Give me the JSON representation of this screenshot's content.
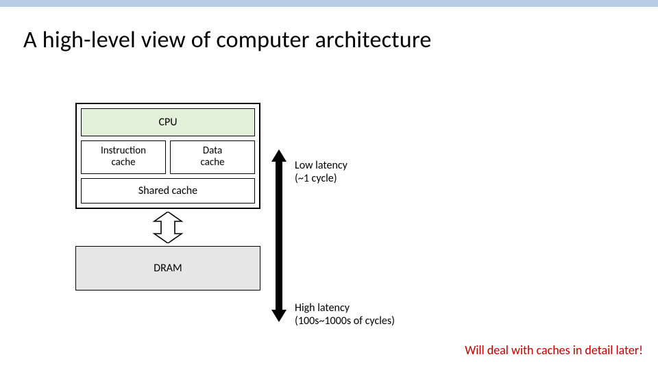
{
  "title": "A high-level view of computer architecture",
  "boxes": {
    "cpu": "CPU",
    "icache": "Instruction\ncache",
    "dcache": "Data\ncache",
    "shared": "Shared cache",
    "dram": "DRAM"
  },
  "latency": {
    "low_l1": "Low latency",
    "low_l2": "(~1 cycle)",
    "high_l1": "High latency",
    "high_l2": "(100s~1000s of cycles)"
  },
  "footnote": "Will deal with caches in detail later!"
}
